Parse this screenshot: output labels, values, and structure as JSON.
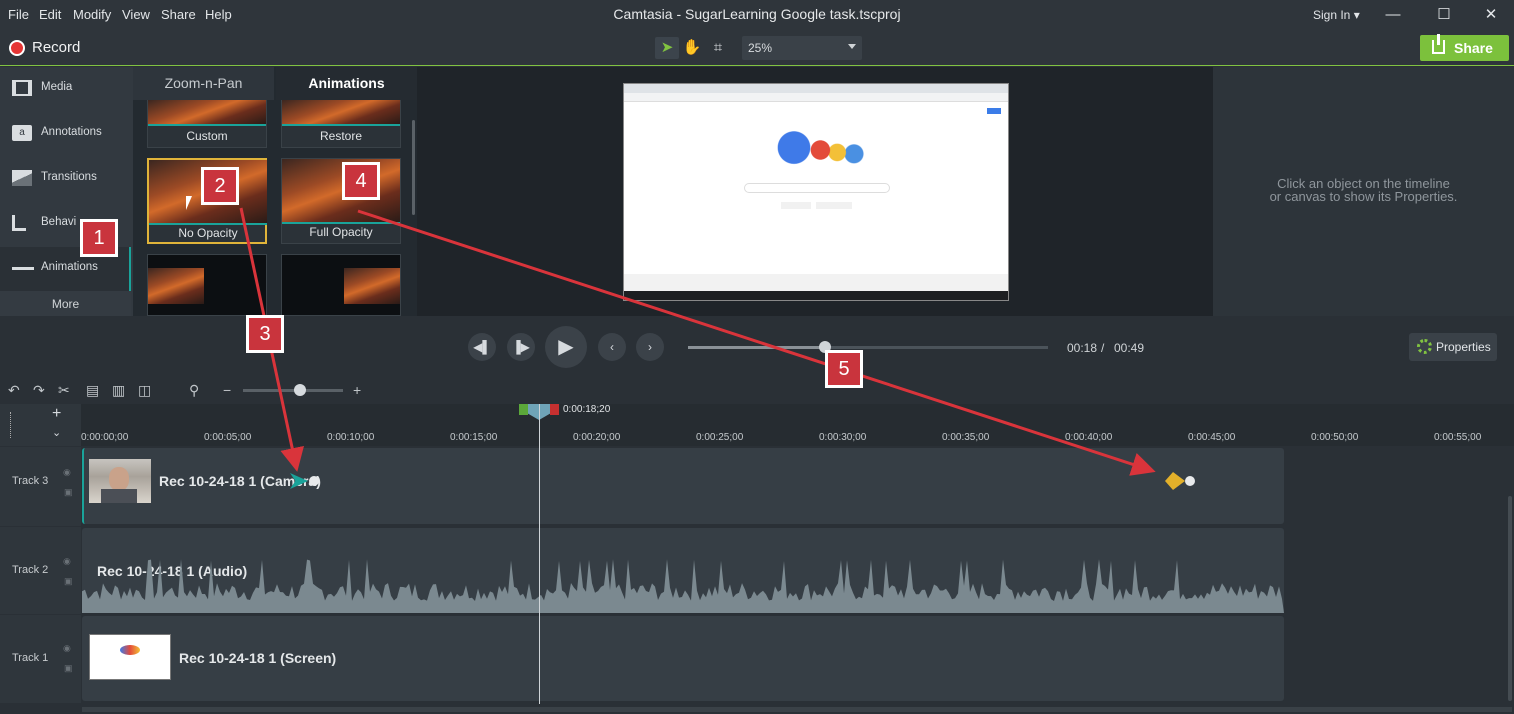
{
  "menu": [
    "File",
    "Edit",
    "Modify",
    "View",
    "Share",
    "Help"
  ],
  "title": "Camtasia - SugarLearning Google task.tscproj",
  "signin": "Sign In",
  "window_controls": [
    "minimize-icon",
    "maximize-icon",
    "close-icon"
  ],
  "toolbar": {
    "record_label": "Record",
    "zoom_value": "25%",
    "share_label": "Share"
  },
  "sidebar": {
    "items": [
      {
        "label": "Media",
        "icon": "film-icon"
      },
      {
        "label": "Annotations",
        "icon": "annotation-icon"
      },
      {
        "label": "Transitions",
        "icon": "transition-icon"
      },
      {
        "label": "Behaviors",
        "icon": "behaviors-icon"
      },
      {
        "label": "Animations",
        "icon": "animation-icon"
      }
    ],
    "more_label": "More",
    "behaviors_visible": "Behavi"
  },
  "panel": {
    "tabs": [
      {
        "label": "Zoom-n-Pan"
      },
      {
        "label": "Animations",
        "active": true
      }
    ],
    "thumbs": [
      {
        "label": "Custom"
      },
      {
        "label": "Restore"
      },
      {
        "label": "No Opacity",
        "selected": true
      },
      {
        "label": "Full Opacity"
      },
      {
        "label": ""
      },
      {
        "label": ""
      }
    ]
  },
  "properties": {
    "message_line1": "Click an object on the timeline",
    "message_line2": "or canvas to show its Properties."
  },
  "transport": {
    "current": "00:18",
    "separator": "/",
    "total": "00:49",
    "properties_label": "Properties",
    "progress": 0.37
  },
  "timeline": {
    "playhead_time": "0:00:18;20",
    "ticks": [
      "0:00:00;00",
      "0:00:05;00",
      "0:00:10;00",
      "0:00:15;00",
      "0:00:20;00",
      "0:00:25;00",
      "0:00:30;00",
      "0:00:35;00",
      "0:00:40;00",
      "0:00:45;00",
      "0:00:50;00",
      "0:00:55;00"
    ],
    "tracks": [
      {
        "label": "Track 3",
        "clip": "Rec 10-24-18 1 (Camera)"
      },
      {
        "label": "Track 2",
        "clip": "Rec 10-24-18 1 (Audio)"
      },
      {
        "label": "Track 1",
        "clip": "Rec 10-24-18 1 (Screen)"
      }
    ]
  },
  "callouts": [
    "1",
    "2",
    "3",
    "4",
    "5"
  ],
  "colors": {
    "accent": "#81c341",
    "callout": "#c9343d",
    "arrow": "#d9343b",
    "anim_in": "#1aa39a",
    "anim_out": "#e3b02a"
  }
}
